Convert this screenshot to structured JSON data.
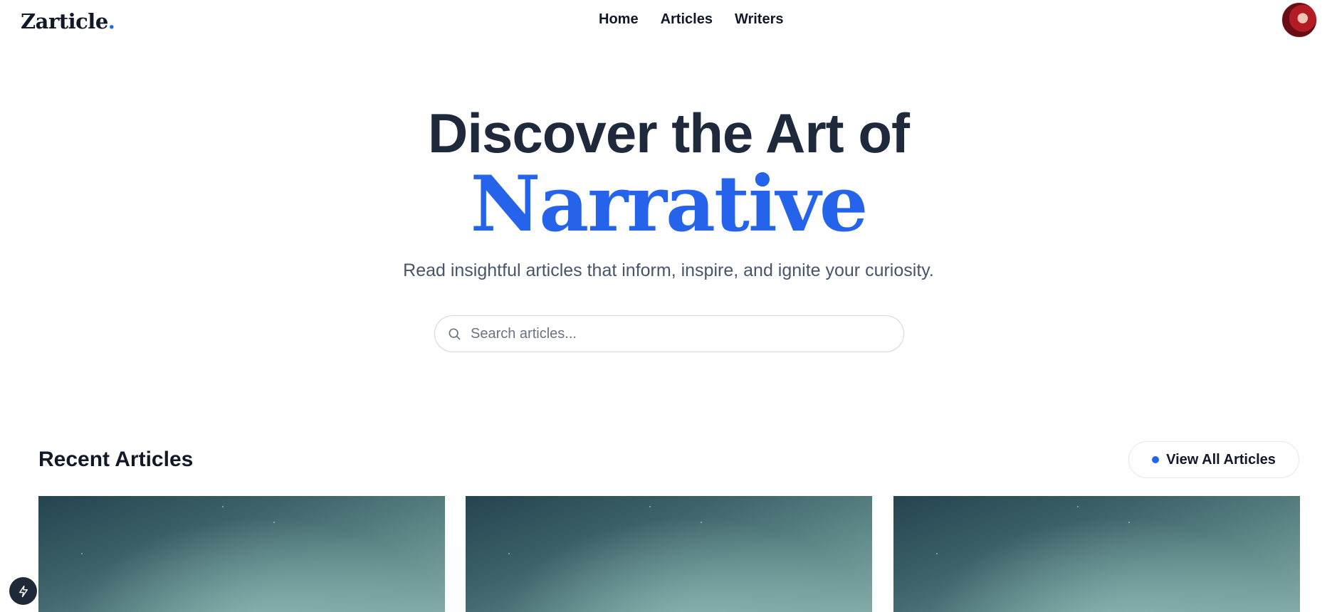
{
  "header": {
    "logo": "Zarticle",
    "logo_dot": ".",
    "nav": [
      "Home",
      "Articles",
      "Writers"
    ],
    "avatar_icon": "user-avatar"
  },
  "hero": {
    "title": "Discover the Art of",
    "accent": "Narrative",
    "subtitle": "Read insightful articles that inform, inspire, and ignite your curiosity.",
    "search": {
      "placeholder": "Search articles...",
      "value": ""
    }
  },
  "recent": {
    "title": "Recent Articles",
    "view_all_label": "View All Articles",
    "card_count": 3
  },
  "colors": {
    "accent": "#2563eb",
    "heading": "#1e293b",
    "body_text": "#475569"
  },
  "dev_tools_icon": "lightning-bolt-icon"
}
